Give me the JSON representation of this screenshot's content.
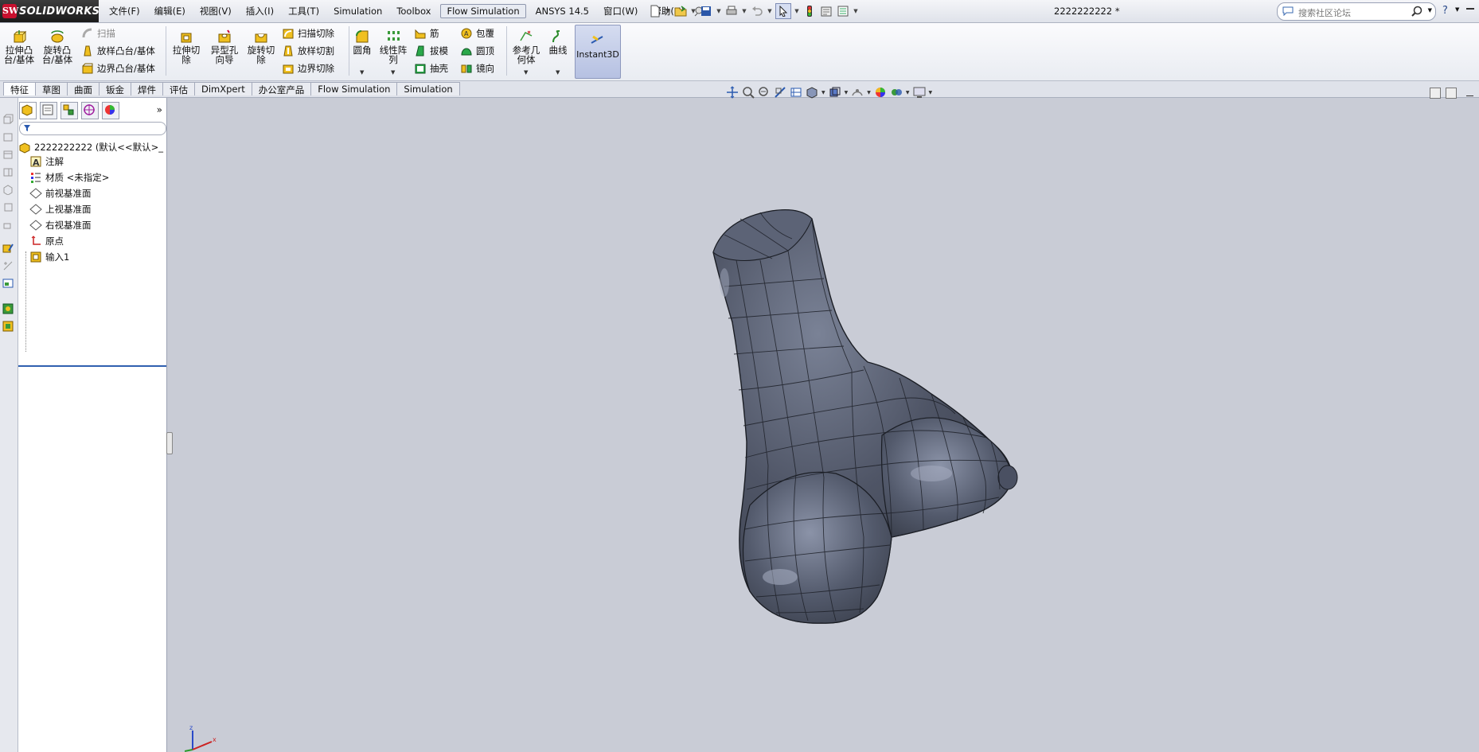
{
  "app": {
    "brand": "SOLIDWORKS",
    "document_title": "2222222222 *"
  },
  "menu": [
    "文件(F)",
    "编辑(E)",
    "视图(V)",
    "插入(I)",
    "工具(T)",
    "Simulation",
    "Toolbox",
    "Flow Simulation",
    "ANSYS 14.5",
    "窗口(W)",
    "帮助(H)"
  ],
  "search": {
    "placeholder": "搜索社区论坛"
  },
  "help_label": "?",
  "ribbon": {
    "extrude_boss": "拉伸凸\n台/基体",
    "revolve_boss": "旋转凸\n台/基体",
    "sweep": "扫描",
    "loft": "放样凸台/基体",
    "boundary_boss": "边界凸台/基体",
    "extrude_cut": "拉伸切\n除",
    "hole_wizard": "异型孔\n向导",
    "revolve_cut": "旋转切\n除",
    "swept_cut": "扫描切除",
    "lofted_cut": "放样切割",
    "boundary_cut": "边界切除",
    "fillet": "圆角",
    "linear_pattern": "线性阵\n列",
    "rib": "筋",
    "draft": "拔模",
    "shell": "抽壳",
    "wrap": "包覆",
    "dome": "圆顶",
    "mirror": "镜向",
    "ref_geometry": "参考几\n何体",
    "curves": "曲线",
    "instant3d": "Instant3D"
  },
  "tabs": [
    "特征",
    "草图",
    "曲面",
    "钣金",
    "焊件",
    "评估",
    "DimXpert",
    "办公室产品",
    "Flow Simulation",
    "Simulation"
  ],
  "active_tab": "特征",
  "tree": {
    "root": "2222222222  (默认<<默认>_",
    "items": [
      "注解",
      "材质 <未指定>",
      "前视基准面",
      "上视基准面",
      "右视基准面",
      "原点",
      "输入1"
    ]
  },
  "axis_labels": {
    "x": "x",
    "y": "y",
    "z": "z"
  },
  "colors": {
    "part_fill": "#4f5566",
    "viewport_bg": "#c9ccd6",
    "brand_red": "#c8102e",
    "instant3d_active": "#b6c1e2"
  }
}
